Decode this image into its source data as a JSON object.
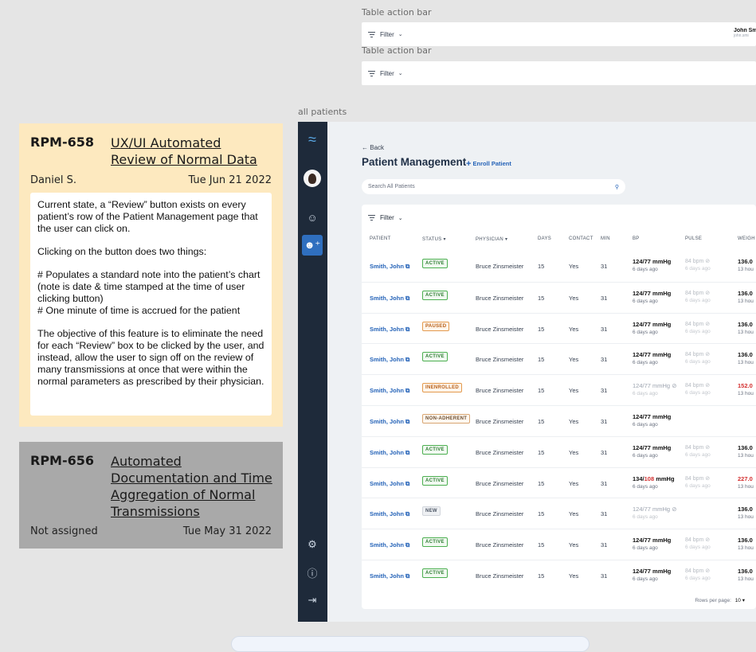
{
  "top_frames": [
    {
      "label": "Table action bar",
      "filter": "Filter",
      "user_name": "John Sm",
      "user_email": "john.smi"
    },
    {
      "label": "Table action bar",
      "filter": "Filter"
    }
  ],
  "all_patients_label": "all patients",
  "tickets": [
    {
      "id": "RPM-658",
      "title": "UX/UI Automated Review of Normal Data",
      "assignee": "Daniel S.",
      "date": "Tue Jun 21 2022",
      "paragraphs": [
        "Current state, a “Review” button exists on every patient’s row of the Patient Management page that the user can click on.",
        "Clicking on the button does two things:",
        "# Populates a standard note into the patient’s chart (note is date & time stamped at the time of user clicking button)",
        "# One minute of time is accrued for the patient",
        "The objective of this feature is to eliminate the need for each “Review” box to be clicked by the user, and instead, allow the user to sign off on the review of many transmissions at once that were within the normal parameters as prescribed by their physician."
      ],
      "bg": "#fde9bf"
    },
    {
      "id": "RPM-656",
      "title": "Automated Documentation and Time Aggregation of Normal Transmissions",
      "assignee": "Not assigned",
      "date": "Tue May 31 2022",
      "bg": "#a9a9a9"
    }
  ],
  "app": {
    "back": "Back",
    "title": "Patient Management",
    "enroll": "Enroll Patient",
    "search_placeholder": "Search All Patients",
    "filter": "Filter",
    "columns": [
      "PATIENT",
      "STATUS",
      "PHYSICIAN",
      "DAYS",
      "CONTACT",
      "MIN",
      "BP",
      "PULSE",
      "WEIGH"
    ],
    "rows_per_page_label": "Rows per page:",
    "rows_per_page": "10",
    "rows": [
      {
        "patient": "Smith, John",
        "status": "ACTIVE",
        "physician": "Bruce Zinsmeister",
        "days": "15",
        "contact": "Yes",
        "min": "31",
        "bp": "124/77 mmHg",
        "bp_when": "6 days ago",
        "pulse": "84 bpm",
        "pulse_when": "6 days ago",
        "weight": "136.0",
        "weight_when": "13 hou"
      },
      {
        "patient": "Smith, John",
        "status": "ACTIVE",
        "physician": "Bruce Zinsmeister",
        "days": "15",
        "contact": "Yes",
        "min": "31",
        "bp": "124/77 mmHg",
        "bp_when": "6 days ago",
        "pulse": "84 bpm",
        "pulse_when": "6 days ago",
        "weight": "136.0",
        "weight_when": "13 hou"
      },
      {
        "patient": "Smith, John",
        "status": "PAUSED",
        "physician": "Bruce Zinsmeister",
        "days": "15",
        "contact": "Yes",
        "min": "31",
        "bp": "124/77 mmHg",
        "bp_when": "6 days ago",
        "pulse": "84 bpm",
        "pulse_when": "6 days ago",
        "weight": "136.0",
        "weight_when": "13 hou"
      },
      {
        "patient": "Smith, John",
        "status": "ACTIVE",
        "physician": "Bruce Zinsmeister",
        "days": "15",
        "contact": "Yes",
        "min": "31",
        "bp": "124/77 mmHg",
        "bp_when": "6 days ago",
        "pulse": "84 bpm",
        "pulse_when": "6 days ago",
        "weight": "136.0",
        "weight_when": "13 hou"
      },
      {
        "patient": "Smith, John",
        "status": "INENROLLED",
        "physician": "Bruce Zinsmeister",
        "days": "15",
        "contact": "Yes",
        "min": "31",
        "bp": "124/77 mmHg",
        "bp_when": "6 days ago",
        "pulse": "84 bpm",
        "pulse_when": "6 days ago",
        "weight": "152.0",
        "weight_when": "13 hou"
      },
      {
        "patient": "Smith, John",
        "status": "NON-ADHERENT",
        "physician": "Bruce Zinsmeister",
        "days": "15",
        "contact": "Yes",
        "min": "31",
        "bp": "124/77 mmHg",
        "bp_when": "6 days ago",
        "pulse": "",
        "pulse_when": "",
        "weight": "",
        "weight_when": ""
      },
      {
        "patient": "Smith, John",
        "status": "ACTIVE",
        "physician": "Bruce Zinsmeister",
        "days": "15",
        "contact": "Yes",
        "min": "31",
        "bp": "124/77 mmHg",
        "bp_when": "6 days ago",
        "pulse": "84 bpm",
        "pulse_when": "6 days ago",
        "weight": "136.0",
        "weight_when": "13 hou"
      },
      {
        "patient": "Smith, John",
        "status": "ACTIVE",
        "physician": "Bruce Zinsmeister",
        "days": "15",
        "contact": "Yes",
        "min": "31",
        "bp_sys": "134/",
        "bp_dia": "108",
        "bp_unit": " mmHg",
        "bp_when": "6 days ago",
        "pulse": "84 bpm",
        "pulse_when": "6 days ago",
        "weight": "227.0",
        "weight_when": "13 hou"
      },
      {
        "patient": "Smith, John",
        "status": "NEW",
        "physician": "Bruce Zinsmeister",
        "days": "15",
        "contact": "Yes",
        "min": "31",
        "bp": "124/77 mmHg",
        "bp_when": "6 days ago",
        "pulse": "",
        "pulse_when": "",
        "weight": "136.0",
        "weight_when": "13 hou"
      },
      {
        "patient": "Smith, John",
        "status": "ACTIVE",
        "physician": "Bruce Zinsmeister",
        "days": "15",
        "contact": "Yes",
        "min": "31",
        "bp": "124/77 mmHg",
        "bp_when": "6 days ago",
        "pulse": "84 bpm",
        "pulse_when": "6 days ago",
        "weight": "136.0",
        "weight_when": "13 hou"
      },
      {
        "patient": "Smith, John",
        "status": "ACTIVE",
        "physician": "Bruce Zinsmeister",
        "days": "15",
        "contact": "Yes",
        "min": "31",
        "bp": "124/77 mmHg",
        "bp_when": "6 days ago",
        "pulse": "84 bpm",
        "pulse_when": "6 days ago",
        "weight": "136.0",
        "weight_when": "13 hou"
      }
    ]
  },
  "colors": {
    "accent": "#2563b8",
    "sidebar": "#1e2a3a",
    "alert": "#d32f2f"
  }
}
